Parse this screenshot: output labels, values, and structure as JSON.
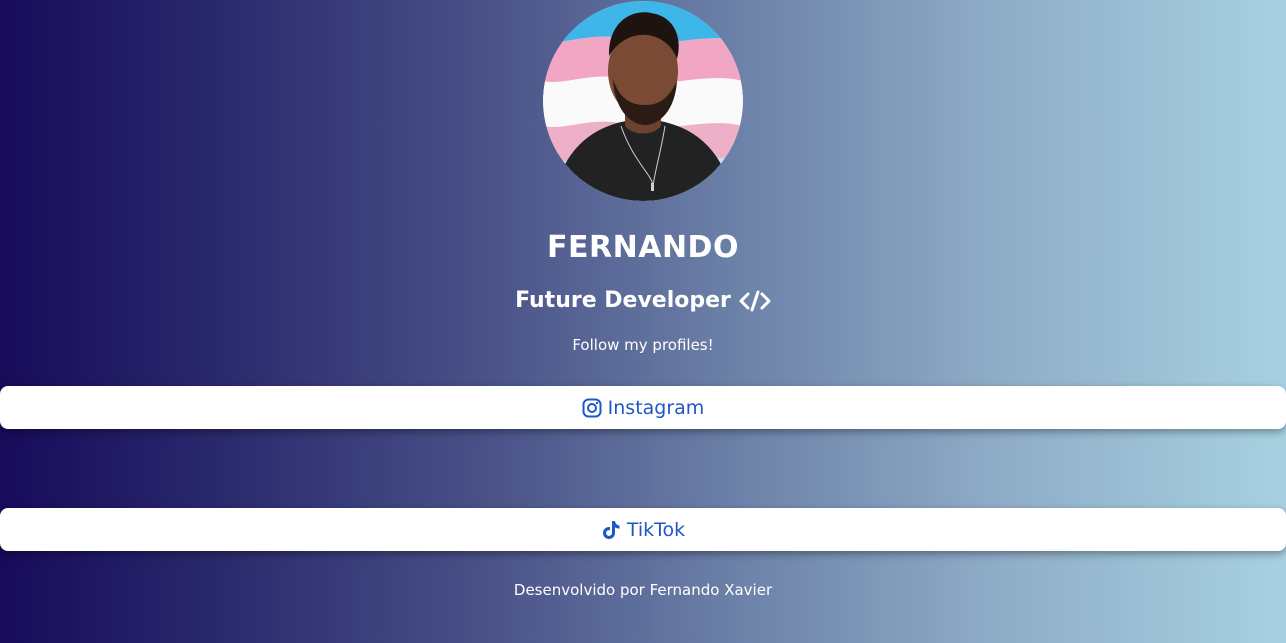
{
  "profile": {
    "name": "FERNANDO",
    "role": "Future Developer",
    "role_icon": "code-icon",
    "avatar_alt": "profile-photo"
  },
  "follow_text": "Follow my profiles!",
  "links": [
    {
      "label": "Instagram",
      "icon": "instagram-icon"
    },
    {
      "label": "TikTok",
      "icon": "tiktok-icon"
    }
  ],
  "footer": {
    "text": "Desenvolvido por Fernando Xavier"
  },
  "colors": {
    "gradient_start": "#170b5a",
    "gradient_end": "#a7d1e1",
    "link_text": "#1f56c8",
    "button_bg": "#ffffff"
  }
}
